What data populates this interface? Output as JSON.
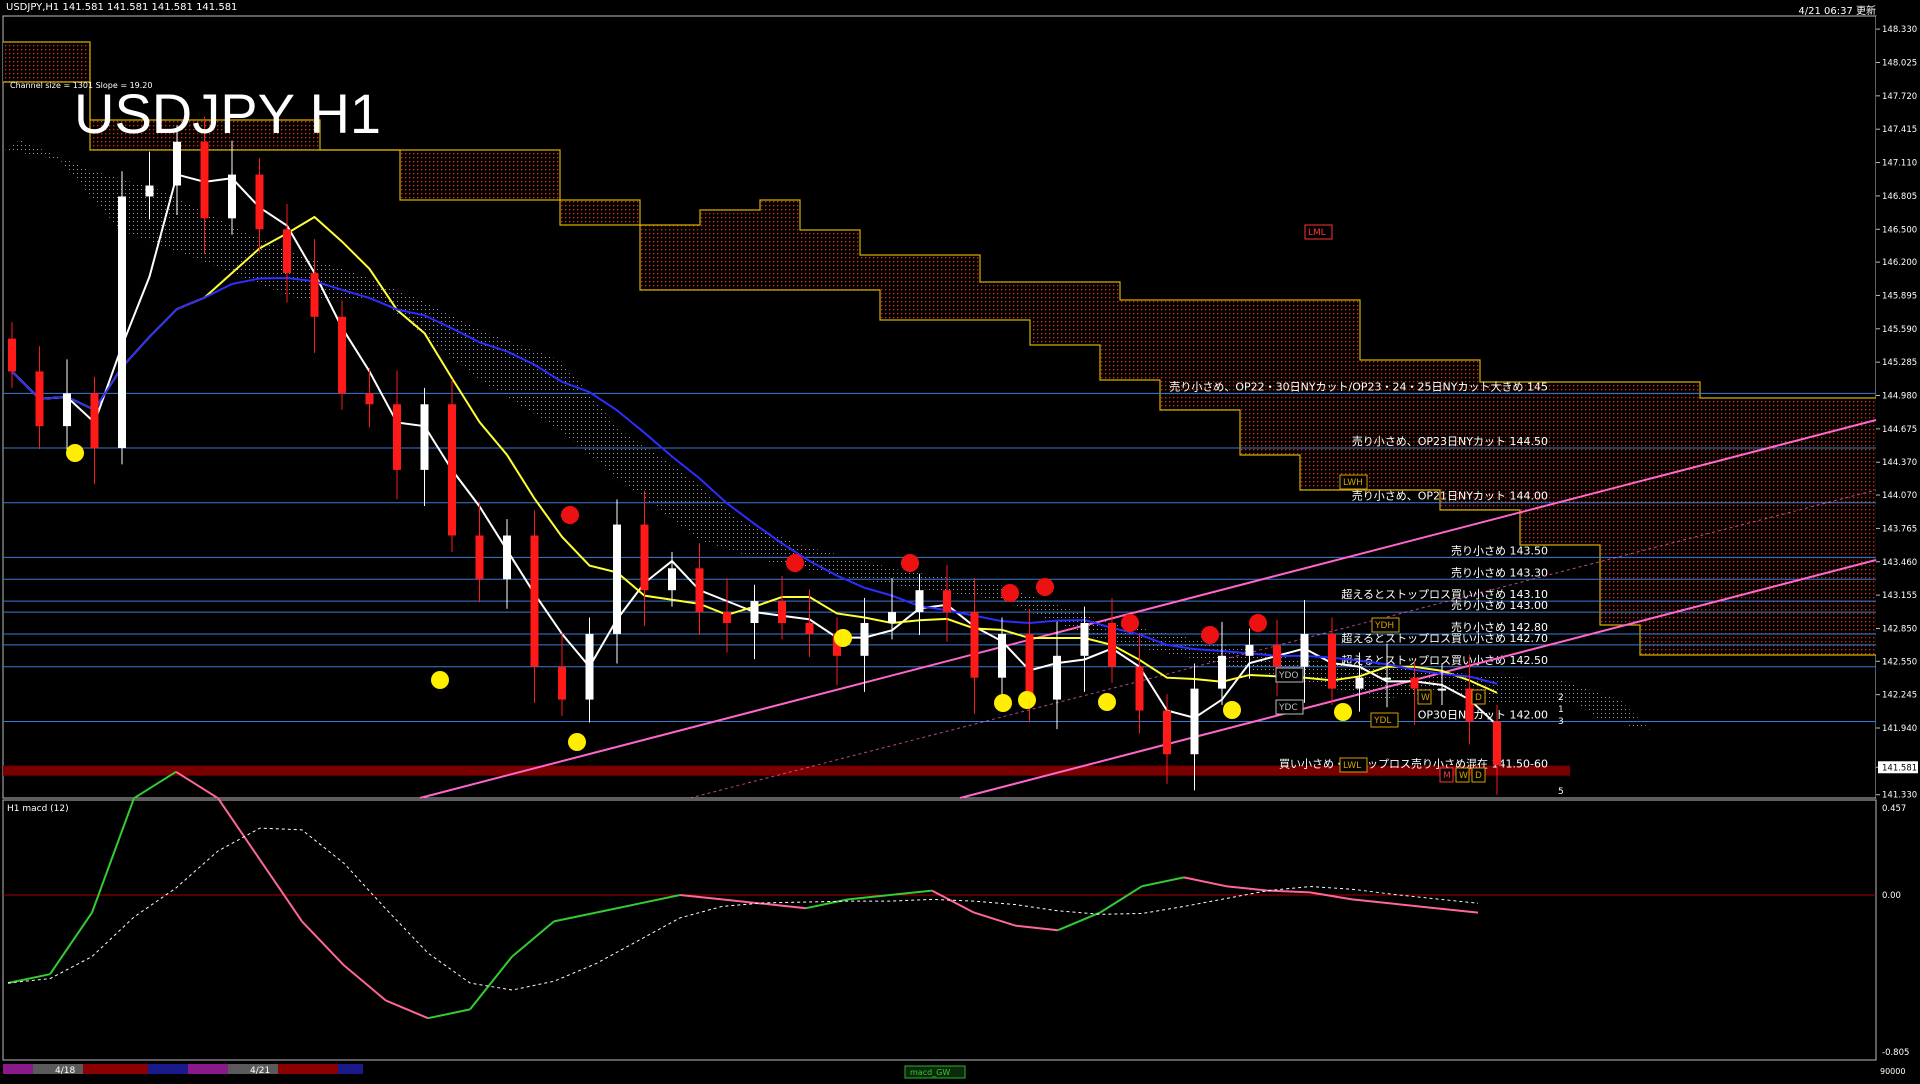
{
  "header": {
    "symbol_info": "USDJPY,H1  141.581 141.581 141.581 141.581",
    "timestamp": "4/21 06:37 更新",
    "big_title": "USDJPY H1",
    "channel_info": "Channel size = 1301 Slope = 19.20"
  },
  "indicator": {
    "label": "H1  macd (12)",
    "ticks": [
      "0.457",
      "0.00",
      "-0.805"
    ]
  },
  "bottom": {
    "date1": "4/18",
    "date2": "4/21",
    "right_label": "90000",
    "tab_label": "macd_GW"
  },
  "colors": {
    "bg": "#000000",
    "bull": "#ffffff",
    "bear": "#ff1a1a",
    "ma_fast": "#ffffff",
    "ma_mid": "#ffff33",
    "ma_slow": "#2d2dff",
    "cloud_bear": "#ff3300",
    "level_line": "#3a7bd5",
    "channel": "#ff66cc",
    "macd_up": "#33cc33",
    "macd_down": "#ff6699"
  },
  "chart_data": {
    "type": "candlestick",
    "title": "USDJPY H1",
    "price_axis": [
      "148.330",
      "148.025",
      "147.720",
      "147.415",
      "147.110",
      "146.805",
      "146.500",
      "146.200",
      "145.895",
      "145.590",
      "145.285",
      "144.980",
      "144.675",
      "144.370",
      "144.070",
      "143.765",
      "143.460",
      "143.155",
      "142.850",
      "142.550",
      "142.245",
      "141.940",
      "141.581",
      "141.330"
    ],
    "current_price": "141.581",
    "ylim": [
      141.3,
      148.45
    ],
    "closes": [
      145.2,
      144.7,
      145.0,
      144.5,
      146.8,
      146.9,
      147.3,
      146.6,
      147.0,
      146.5,
      146.1,
      145.7,
      145.0,
      144.9,
      144.3,
      144.9,
      143.7,
      143.3,
      143.7,
      142.5,
      142.2,
      142.8,
      143.8,
      143.2,
      143.4,
      143.0,
      142.9,
      143.1,
      142.9,
      142.8,
      142.6,
      142.9,
      143.0,
      143.2,
      143.0,
      142.4,
      142.8,
      142.2,
      142.6,
      142.9,
      142.5,
      142.1,
      141.7,
      142.3,
      142.6,
      142.7,
      142.5,
      142.8,
      142.3,
      142.4,
      142.4,
      142.3,
      142.3,
      142.0,
      141.6
    ],
    "levels": [
      {
        "label": "売り小さめ、OP22・30日NYカット/OP23・24・25日NYカット大きめ 145",
        "value": 145.0
      },
      {
        "label": "売り小さめ、OP23日NYカット 144.50",
        "value": 144.5
      },
      {
        "label": "売り小さめ、OP21日NYカット 144.00",
        "value": 144.0
      },
      {
        "label": "売り小さめ 143.50",
        "value": 143.5
      },
      {
        "label": "売り小さめ 143.30",
        "value": 143.3
      },
      {
        "label": "超えるとストップロス買い小さめ 143.10",
        "value": 143.1
      },
      {
        "label": "売り小さめ 143.00",
        "value": 143.0
      },
      {
        "label": "売り小さめ 142.80",
        "value": 142.8
      },
      {
        "label": "超えるとストップロス買い小さめ 142.70",
        "value": 142.7
      },
      {
        "label": "超えるとストップロス買い小さめ 142.50",
        "value": 142.5
      },
      {
        "label": "OP30日NYカット 142.00",
        "value": 142.0
      },
      {
        "label": "買い小さめ・ストップロス売り小さめ混在 141.50-60",
        "value": 141.55
      }
    ],
    "tags": [
      "LML",
      "LWH",
      "YDH",
      "YDO",
      "YDC",
      "YDL",
      "LWL",
      "W",
      "D",
      "M",
      "W",
      "D",
      "2",
      "1",
      "3",
      "5"
    ]
  }
}
